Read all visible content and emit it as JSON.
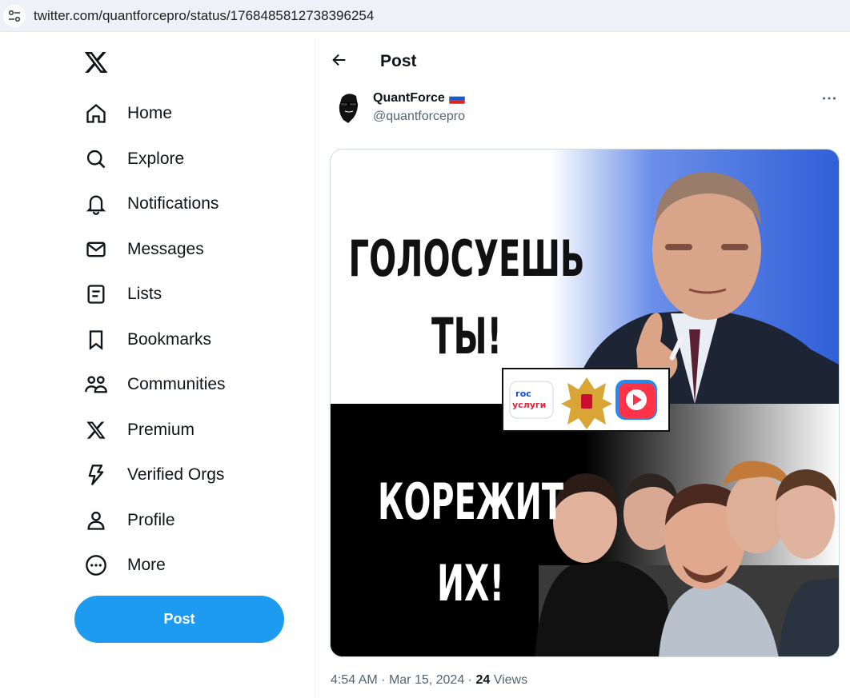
{
  "browser": {
    "url": "twitter.com/quantforcepro/status/1768485812738396254"
  },
  "sidebar": {
    "items": [
      {
        "label": "Home",
        "icon": "home-icon"
      },
      {
        "label": "Explore",
        "icon": "search-icon"
      },
      {
        "label": "Notifications",
        "icon": "bell-icon"
      },
      {
        "label": "Messages",
        "icon": "envelope-icon"
      },
      {
        "label": "Lists",
        "icon": "list-icon"
      },
      {
        "label": "Bookmarks",
        "icon": "bookmark-icon"
      },
      {
        "label": "Communities",
        "icon": "people-icon"
      },
      {
        "label": "Premium",
        "icon": "x-icon"
      },
      {
        "label": "Verified Orgs",
        "icon": "lightning-icon"
      },
      {
        "label": "Profile",
        "icon": "person-icon"
      },
      {
        "label": "More",
        "icon": "more-circle-icon"
      }
    ],
    "post_button": "Post"
  },
  "header": {
    "title": "Post"
  },
  "tweet": {
    "author_name": "QuantForce",
    "author_handle": "@quantforcepro",
    "image_text": {
      "line1": "ГОЛОСУЕШЬ",
      "line2": "ТЫ!",
      "line3": "КОРЕЖИТ",
      "line4": "ИХ!",
      "gos_top": "гос",
      "gos_bottom": "услуги"
    },
    "time": "4:54 AM",
    "date": "Mar 15, 2024",
    "views_count": "24",
    "views_label": "Views"
  },
  "colors": {
    "accent": "#1d9bf0",
    "text": "#0f1419",
    "muted": "#536471"
  }
}
